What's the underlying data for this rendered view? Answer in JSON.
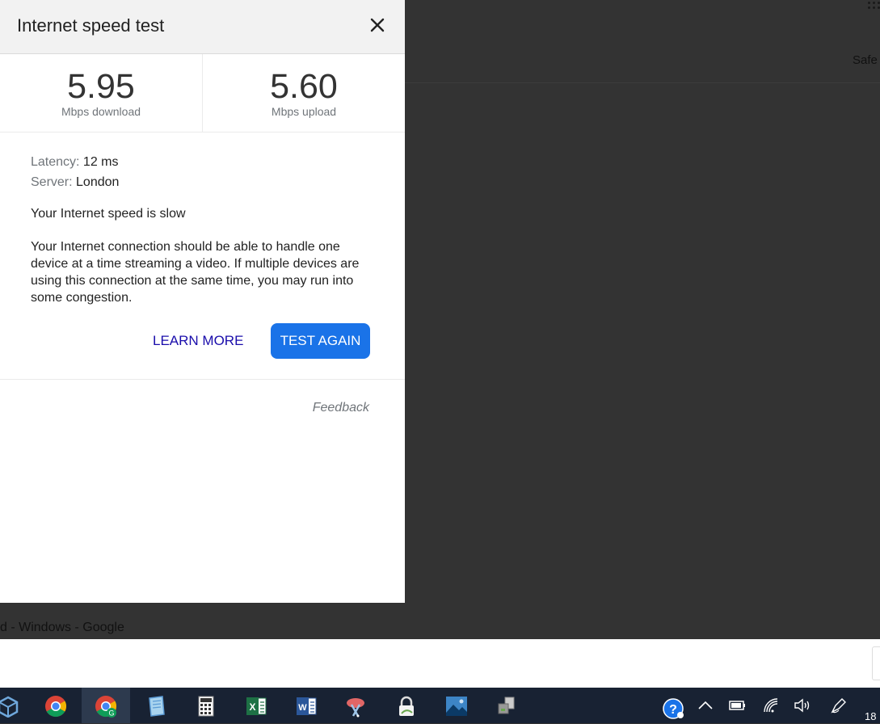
{
  "background": {
    "top_right_text": "Safe",
    "window_caption": "d - Windows - Google"
  },
  "dialog": {
    "title": "Internet speed test",
    "close_icon": "close-icon",
    "download": {
      "value": "5.95",
      "label": "Mbps download"
    },
    "upload": {
      "value": "5.60",
      "label": "Mbps upload"
    },
    "latency_key": "Latency:",
    "latency_value": " 12 ms",
    "server_key": "Server:",
    "server_value": " London",
    "speed_status": "Your Internet speed is slow",
    "explanation": "Your Internet connection should be able to handle one device at a time streaming a video. If multiple devices are using this connection at the same time, you may run into some congestion.",
    "learn_more_label": "LEARN MORE",
    "test_again_label": "TEST AGAIN",
    "feedback_label": "Feedback"
  },
  "taskbar": {
    "apps": [
      "virtualbox-icon",
      "chrome-icon",
      "chrome-profile-icon",
      "notepad-icon",
      "calculator-icon",
      "excel-icon",
      "word-icon",
      "snipping-tool-icon",
      "vpn-lock-icon",
      "photos-icon",
      "network-drive-icon"
    ],
    "tray": [
      "help-icon",
      "chevron-up-icon",
      "battery-icon",
      "wifi-icon",
      "volume-icon",
      "pen-icon"
    ],
    "clock": "18"
  },
  "colors": {
    "accent": "#1a73e8",
    "link": "#1a0dab",
    "overlay": "#333333",
    "taskbar": "#182233"
  }
}
